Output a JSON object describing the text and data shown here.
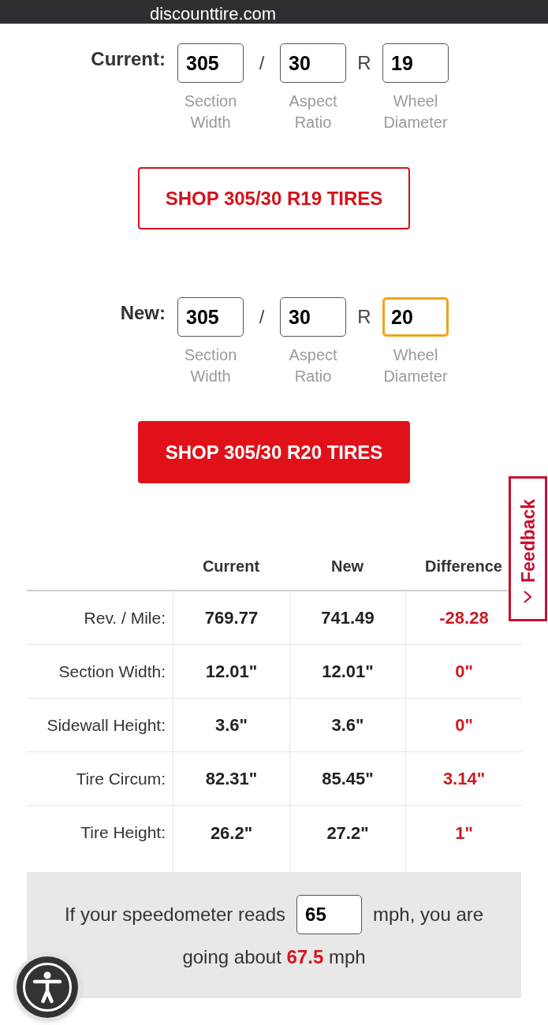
{
  "address_bar": {
    "url": "discounttire.com"
  },
  "sections": [
    {
      "label": "Current:",
      "fields": [
        {
          "value": "305",
          "caption": "Section Width",
          "focused": false,
          "separator": "/"
        },
        {
          "value": "30",
          "caption": "Aspect Ratio",
          "focused": false,
          "separator": "R"
        },
        {
          "value": "19",
          "caption": "Wheel Diameter",
          "focused": false
        }
      ],
      "shop_button": {
        "label": "SHOP 305/30 R19 TIRES",
        "kind": "outline"
      }
    },
    {
      "label": "New:",
      "fields": [
        {
          "value": "305",
          "caption": "Section Width",
          "focused": false,
          "separator": "/"
        },
        {
          "value": "30",
          "caption": "Aspect Ratio",
          "focused": false,
          "separator": "R"
        },
        {
          "value": "20",
          "caption": "Wheel Diameter",
          "focused": true
        }
      ],
      "shop_button": {
        "label": "SHOP 305/30 R20 TIRES",
        "kind": "filled"
      }
    }
  ],
  "comparison_table": {
    "columns": [
      "Current",
      "New",
      "Difference"
    ],
    "rows": [
      {
        "label": "Rev. / Mile:",
        "values": [
          "769.77",
          "741.49",
          "-28.28"
        ]
      },
      {
        "label": "Section Width:",
        "values": [
          "12.01\"",
          "12.01\"",
          "0\""
        ]
      },
      {
        "label": "Sidewall Height:",
        "values": [
          "3.6\"",
          "3.6\"",
          "0\""
        ]
      },
      {
        "label": "Tire Circum:",
        "values": [
          "82.31\"",
          "85.45\"",
          "3.14\""
        ]
      },
      {
        "label": "Tire Height:",
        "values": [
          "26.2\"",
          "27.2\"",
          "1\""
        ]
      }
    ]
  },
  "speedometer": {
    "prefix": "If your speedometer reads",
    "value": "65",
    "suffix": "mph, you are",
    "result": "going about **67.5** mph"
  },
  "feedback_tab": {
    "label": "Feedback"
  }
}
